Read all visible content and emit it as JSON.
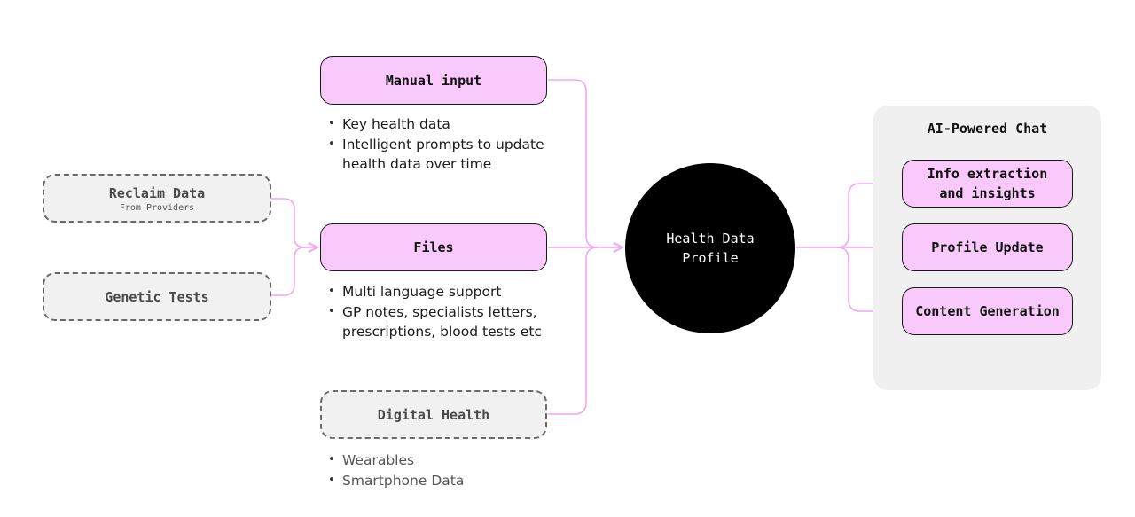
{
  "colors": {
    "accent_pink": "#f9c9fb",
    "connector_pink": "#f0a6f3",
    "dashed_box_bg": "#f1f1f1",
    "hub": "#000000",
    "panel_bg": "#f0f0f0"
  },
  "sources": {
    "reclaim_data": {
      "title": "Reclaim Data",
      "subtitle": "From Providers"
    },
    "genetic_tests": {
      "title": "Genetic Tests"
    }
  },
  "inputs": {
    "manual_input": {
      "title": "Manual input",
      "bullets": [
        "Key health data",
        "Intelligent prompts to update health data over time"
      ]
    },
    "files": {
      "title": "Files",
      "bullets": [
        "Multi language support",
        "GP notes, specialists letters, prescriptions, blood tests etc"
      ]
    },
    "digital_health": {
      "title": "Digital Health",
      "bullets": [
        "Wearables",
        "Smartphone Data"
      ]
    }
  },
  "hub": {
    "label": "Health Data Profile"
  },
  "ai_chat": {
    "title": "AI-Powered Chat",
    "items": [
      {
        "label": "Info extraction and insights"
      },
      {
        "label": "Profile Update"
      },
      {
        "label": "Content Generation"
      }
    ]
  }
}
